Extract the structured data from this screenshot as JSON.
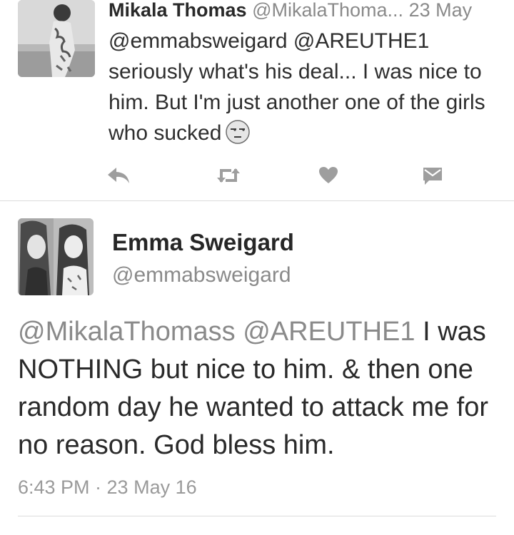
{
  "tweet1": {
    "name": "Mikala Thomas",
    "handle": "@MikalaThoma...",
    "date": "23 May",
    "body": "@emmabsweigard @AREUTHE1 seriously what's his deal... I was nice to him. But I'm just another one of the girls who sucked",
    "emoji": "unamused-face-emoji",
    "actions": [
      "reply-icon",
      "retweet-icon",
      "like-heart-icon",
      "direct-message-icon"
    ]
  },
  "tweet2": {
    "name": "Emma Sweigard",
    "handle": "@emmabsweigard",
    "mention1": "@MikalaThomass",
    "mention2": "@AREUTHE1",
    "body_text": "I was NOTHING but nice to him. & then one random day he wanted to attack me for no reason. God bless him.",
    "timestamp": "6:43 PM · 23 May 16"
  },
  "colors": {
    "text": "#2b2b2b",
    "muted": "#8a8a8a",
    "icon": "#9e9e9e",
    "divider": "#dcdcdc",
    "background": "#ffffff"
  }
}
